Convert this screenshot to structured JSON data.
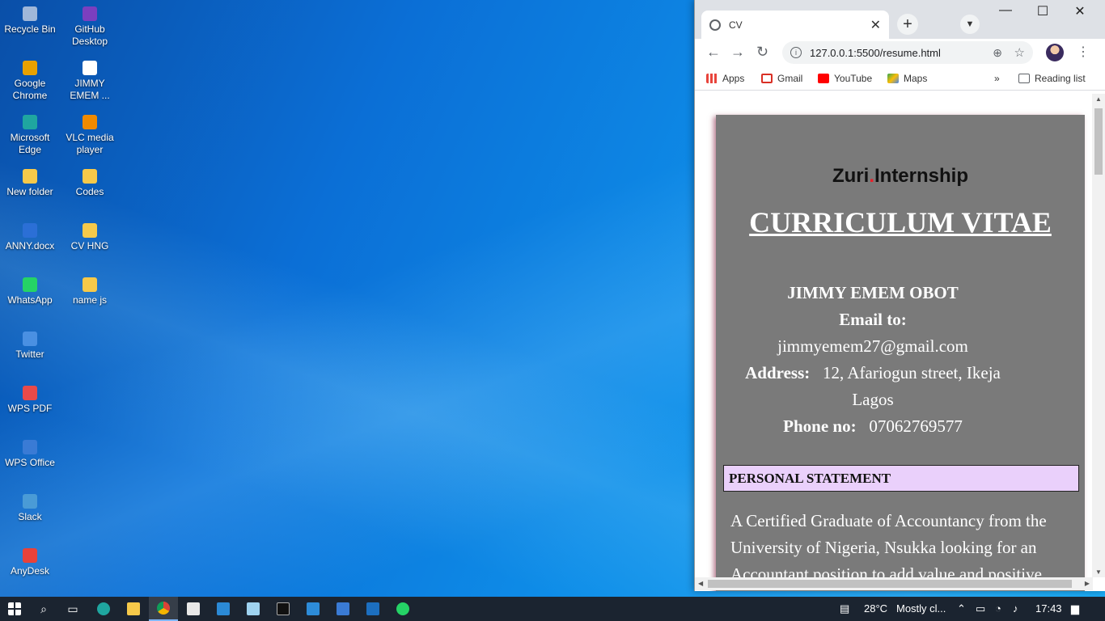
{
  "desktop": {
    "icons": [
      {
        "label": "Recycle Bin",
        "icon": "recycle-bin-icon",
        "color": "#9fb7d9"
      },
      {
        "label": "GitHub Desktop",
        "icon": "github-desktop-icon",
        "color": "#7b3fbf"
      },
      {
        "label": "Google Chrome",
        "icon": "chrome-icon",
        "color": "#e8a100"
      },
      {
        "label": "JIMMY EMEM ...",
        "icon": "pdf-file-icon",
        "color": "#ffffff"
      },
      {
        "label": "Microsoft Edge",
        "icon": "edge-icon",
        "color": "#1fa6a0"
      },
      {
        "label": "VLC media player",
        "icon": "vlc-icon",
        "color": "#f08a00"
      },
      {
        "label": "New folder",
        "icon": "folder-icon",
        "color": "#f6c94a"
      },
      {
        "label": "Codes",
        "icon": "folder-icon",
        "color": "#f6c94a"
      },
      {
        "label": "ANNY.docx",
        "icon": "word-document-icon",
        "color": "#2b6fd6"
      },
      {
        "label": "CV HNG",
        "icon": "folder-icon",
        "color": "#f6c94a"
      },
      {
        "label": "WhatsApp",
        "icon": "whatsapp-icon",
        "color": "#25d366"
      },
      {
        "label": "name js",
        "icon": "folder-icon",
        "color": "#f6c94a"
      },
      {
        "label": "Twitter",
        "icon": "twitter-icon",
        "color": "#4a90e2"
      },
      {
        "label": "WPS PDF",
        "icon": "wps-pdf-icon",
        "color": "#e84a4a"
      },
      {
        "label": "WPS Office",
        "icon": "wps-office-icon",
        "color": "#3a7bd5"
      },
      {
        "label": "Slack",
        "icon": "slack-icon",
        "color": "#4a9bd6"
      },
      {
        "label": "AnyDesk",
        "icon": "anydesk-icon",
        "color": "#e8423a"
      }
    ]
  },
  "browser": {
    "tab_title": "CV",
    "tab_close": "✕",
    "new_tab": "+",
    "url": "127.0.0.1:5500/resume.html",
    "bookmarks": {
      "apps": "Apps",
      "gmail": "Gmail",
      "youtube": "YouTube",
      "maps": "Maps",
      "more": "»",
      "reading_list": "Reading list"
    }
  },
  "cv": {
    "logo_left": "Zuri",
    "logo_dot": ".",
    "logo_right": "Internship",
    "title": "CURRICULUM VITAE",
    "name": "JIMMY EMEM OBOT",
    "email_label": "Email to:",
    "email": "jimmyemem27@gmail.com",
    "address_label": "Address:",
    "address_line1": "12, Afariogun street, Ikeja",
    "address_line2": "Lagos",
    "phone_label": "Phone no:",
    "phone": "07062769577",
    "section_heading": "PERSONAL STATEMENT",
    "statement": "A Certified Graduate of Accountancy from the University of Nigeria, Nsukka looking for an Accountant position to add value and positive"
  },
  "taskbar": {
    "weather": "28°C",
    "weather_desc": "Mostly cl...",
    "time": "17:43"
  }
}
